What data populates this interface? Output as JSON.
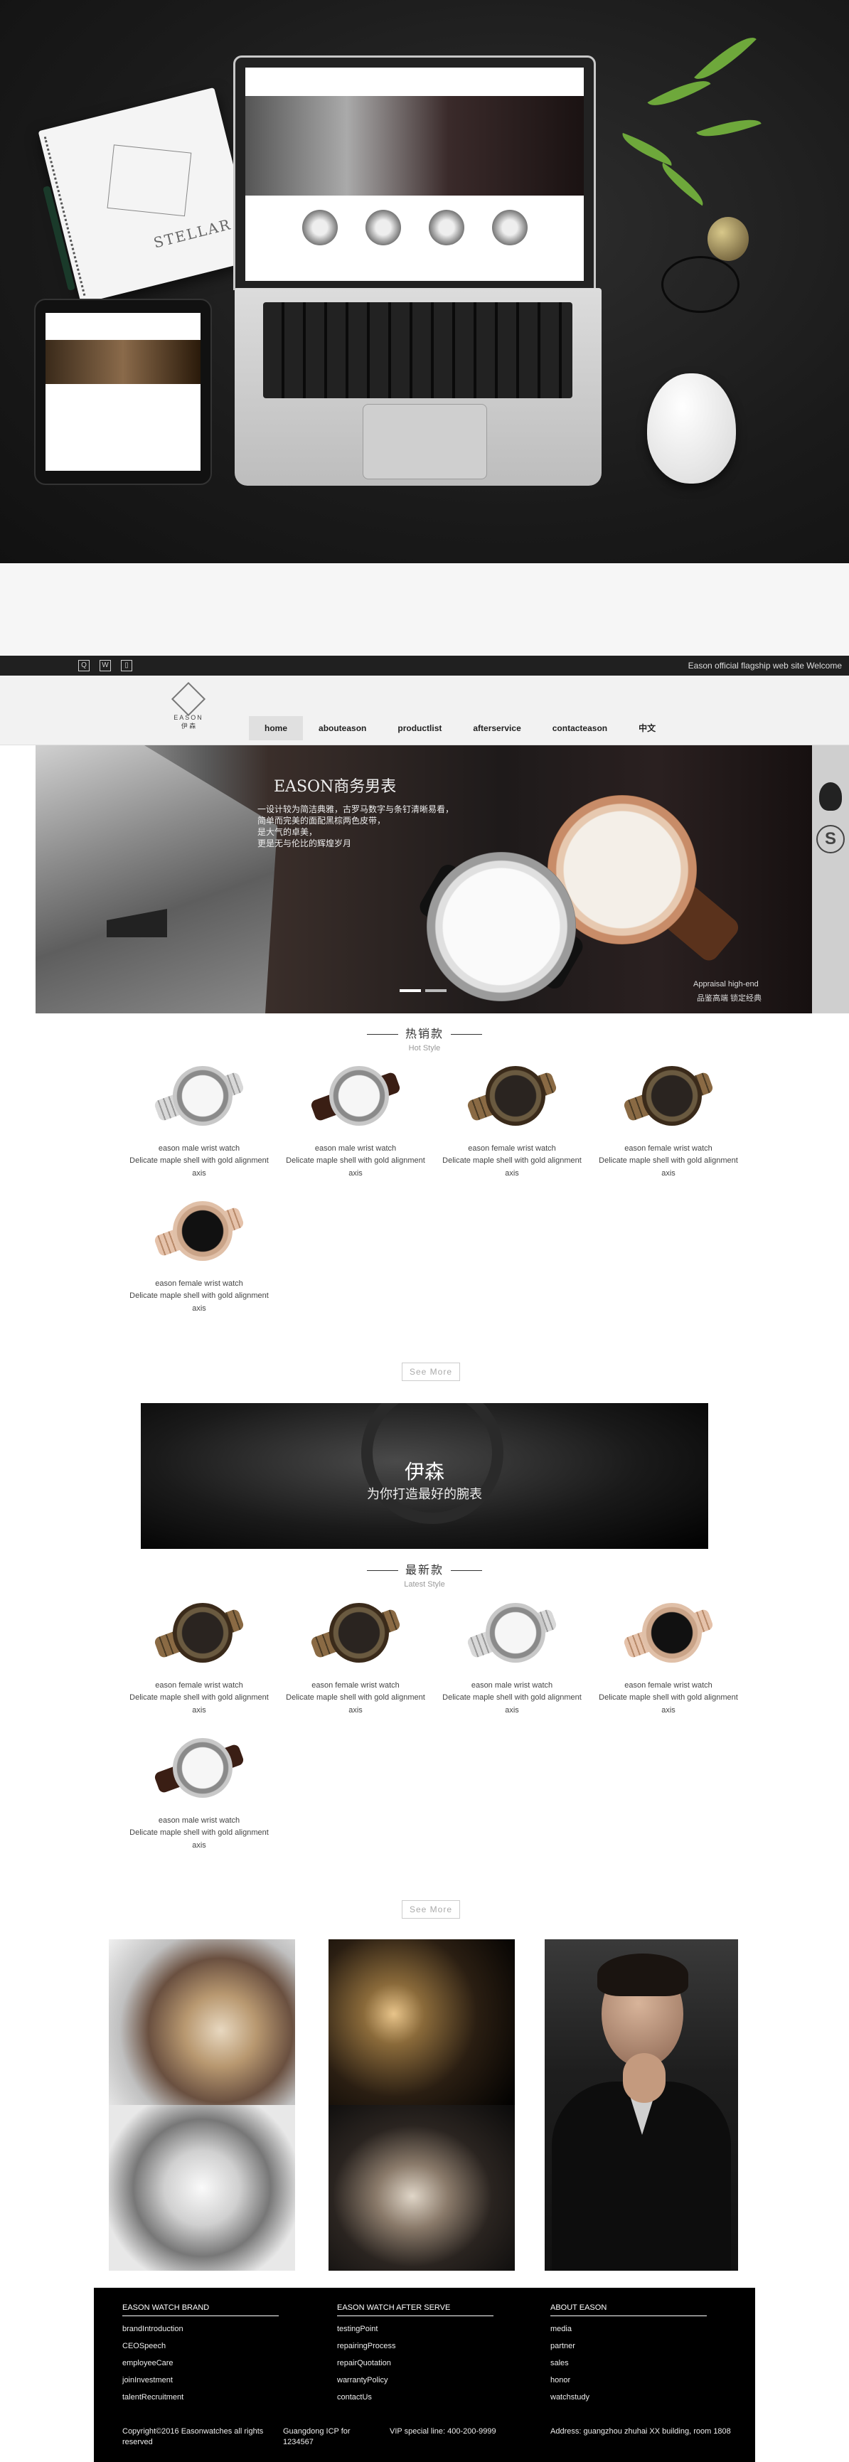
{
  "mockup": {
    "notebook_text": "STELLAR"
  },
  "topbar": {
    "icons": [
      "qq-icon",
      "weibo-icon",
      "phone-icon"
    ],
    "welcome": "Eason official flagship web site Welcome"
  },
  "header": {
    "logo_text": "EASON",
    "logo_cn": "伊 森",
    "nav": [
      "home",
      "abouteason",
      "productlist",
      "afterservice",
      "contacteason",
      "中文"
    ]
  },
  "banner": {
    "title": "EASON商务男表",
    "desc": "一设计较为简洁典雅，古罗马数字与条钉清晰易看，\n简单而完美的面配黑棕两色皮带，\n是大气的卓美，\n更是无与伦比的辉煌岁月",
    "appraisal": "Appraisal high-end",
    "appraisal_cn": "品鉴高端  锁定经典"
  },
  "hot": {
    "title_cn": "热销款",
    "title_en": "Hot Style",
    "more": "See More",
    "items": [
      {
        "style": "steel",
        "name": "eason male wrist watch",
        "desc": "Delicate maple shell with gold alignment axis"
      },
      {
        "style": "leather",
        "name": "eason male wrist watch",
        "desc": "Delicate maple shell with gold alignment axis"
      },
      {
        "style": "wood",
        "name": "eason female wrist watch",
        "desc": "Delicate maple shell with gold alignment axis"
      },
      {
        "style": "wood",
        "name": "eason female wrist watch",
        "desc": "Delicate maple shell with gold alignment axis"
      },
      {
        "style": "rose",
        "name": "eason female wrist watch",
        "desc": "Delicate maple shell with gold alignment axis"
      }
    ]
  },
  "promo": {
    "title": "伊森",
    "subtitle": "为你打造最好的腕表"
  },
  "latest": {
    "title_cn": "最新款",
    "title_en": "Latest Style",
    "more": "See More",
    "items": [
      {
        "style": "wood",
        "name": "eason female wrist watch",
        "desc": "Delicate maple shell with gold alignment axis"
      },
      {
        "style": "wood",
        "name": "eason female wrist watch",
        "desc": "Delicate maple shell with gold alignment axis"
      },
      {
        "style": "steel",
        "name": "eason male wrist watch",
        "desc": "Delicate maple shell with gold alignment axis"
      },
      {
        "style": "rose",
        "name": "eason female wrist watch",
        "desc": "Delicate maple shell with gold alignment axis"
      },
      {
        "style": "leather",
        "name": "eason male wrist watch",
        "desc": "Delicate maple shell with gold alignment axis"
      }
    ]
  },
  "footer": {
    "col1": {
      "heading": "EASON WATCH BRAND",
      "items": [
        "brandIntroduction",
        "CEOSpeech",
        "employeeCare",
        "joinInvestment",
        "talentRecruitment"
      ]
    },
    "col2": {
      "heading": "EASON WATCH AFTER SERVE",
      "items": [
        "testingPoint",
        "repairingProcess",
        "repairQuotation",
        "warrantyPolicy",
        "contactUs"
      ]
    },
    "col3": {
      "heading": "ABOUT EASON",
      "items": [
        "media",
        "partner",
        "sales",
        "honor",
        "watchstudy"
      ]
    },
    "copyright": "Copyright©2016 Easonwatches all rights reserved",
    "icp": "Guangdong ICP for 1234567",
    "vip": "VIP special line: 400-200-9999",
    "address": "Address: guangzhou zhuhai XX building, room 1808"
  }
}
